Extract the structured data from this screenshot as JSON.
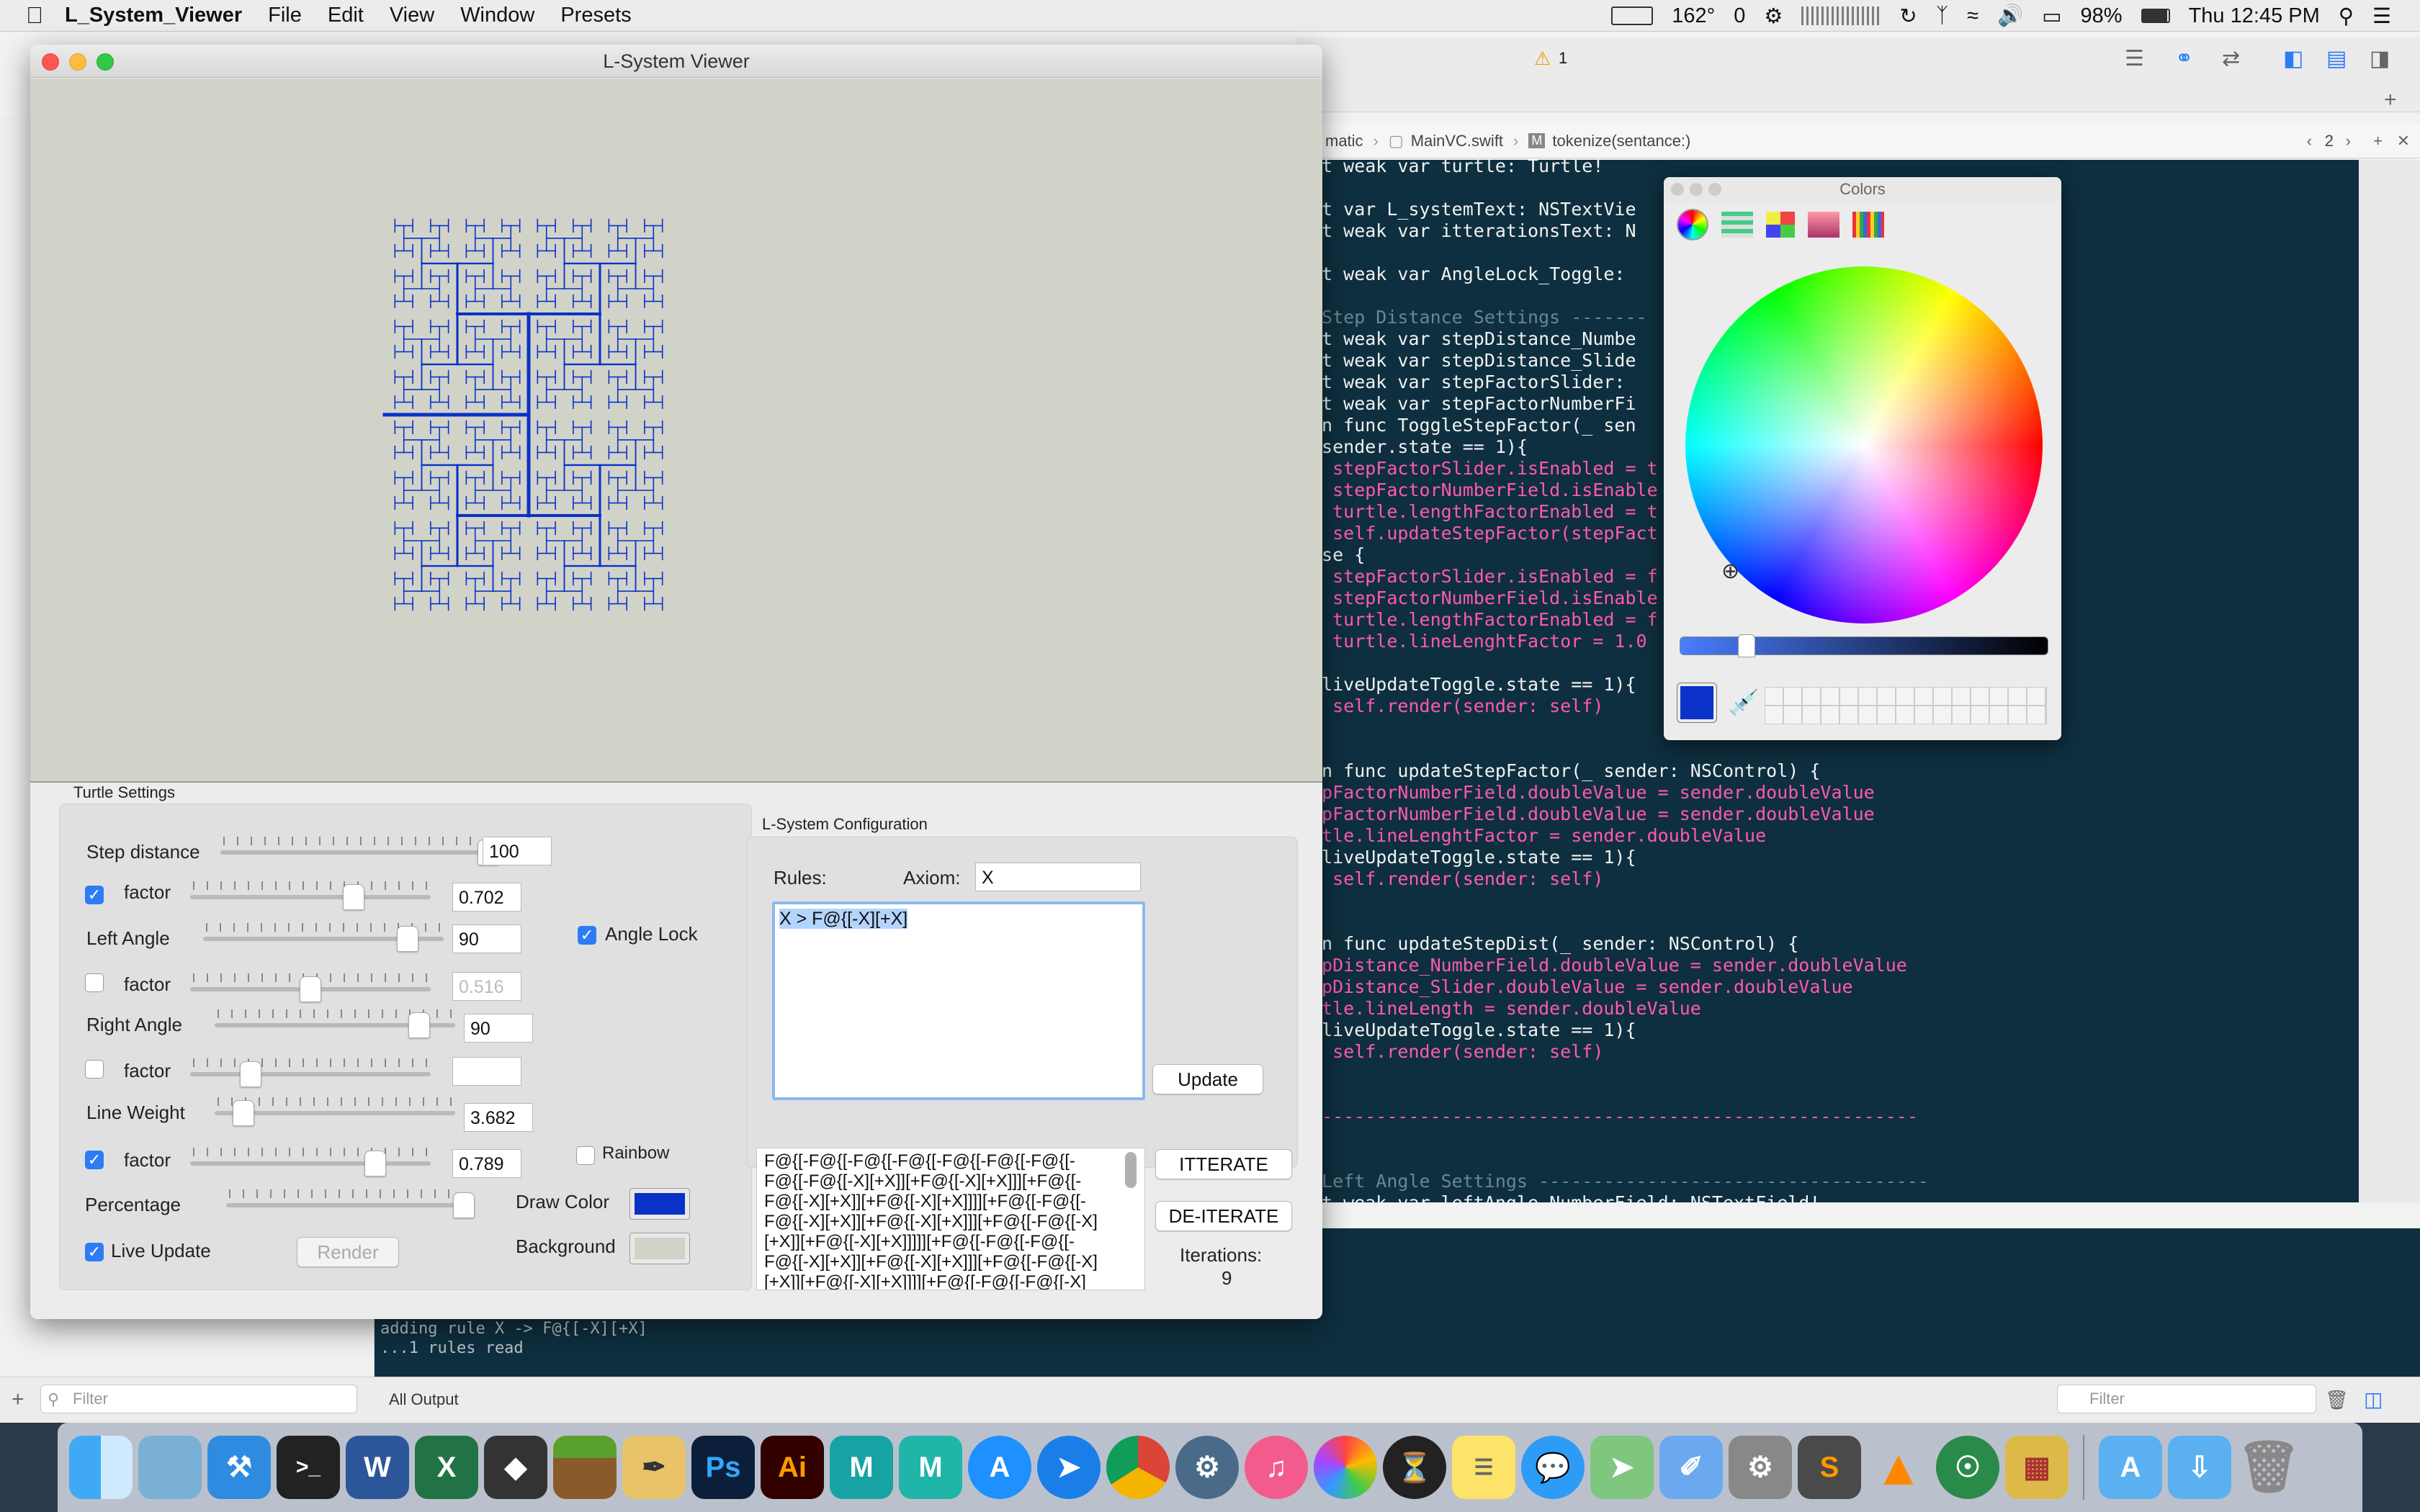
{
  "menubar": {
    "app_name": "L_System_Viewer",
    "items": [
      "File",
      "Edit",
      "View",
      "Window",
      "Presets"
    ],
    "temperature": "162°",
    "counter": "0",
    "battery": "98%",
    "clock": "Thu 12:45 PM"
  },
  "xcode": {
    "warning_count": "1",
    "breadcrumb": [
      "matic",
      "MainVC.swift",
      "tokenize(sentance:)"
    ],
    "page_counter": "2",
    "code_lines": [
      "et weak var turtle: Turtle!",
      "",
      "et var L_systemText: NSTextVie",
      "et weak var itterationsText: N",
      "",
      "et weak var AngleLock_Toggle: ",
      "",
      " Step Distance Settings -------",
      "et weak var stepDistance_Numbe",
      "et weak var stepDistance_Slide",
      "et weak var stepFactorSlider: ",
      "et weak var stepFactorNumberFi",
      "on func ToggleStepFactor(_ sen",
      "(sender.state == 1){",
      "  stepFactorSlider.isEnabled = t",
      "  stepFactorNumberField.isEnable",
      "  turtle.lengthFactorEnabled = t",
      "  self.updateStepFactor(stepFact",
      "lse {",
      "  stepFactorSlider.isEnabled = f",
      "  stepFactorNumberField.isEnable",
      "  turtle.lengthFactorEnabled = f",
      "  turtle.lineLenghtFactor = 1.0",
      "",
      "(liveUpdateToggle.state == 1){",
      "  self.render(sender: self)",
      "",
      "",
      "on func updateStepFactor(_ sender: NSControl) {",
      "epFactorNumberField.doubleValue = sender.doubleValue",
      "epFactorNumberField.doubleValue = sender.doubleValue",
      "rtle.lineLenghtFactor = sender.doubleValue",
      "(liveUpdateToggle.state == 1){",
      "  self.render(sender: self)",
      "",
      "",
      "on func updateStepDist(_ sender: NSControl) {",
      "epDistance_NumberField.doubleValue = sender.doubleValue",
      "epDistance_Slider.doubleValue = sender.doubleValue",
      "rtle.lineLength = sender.doubleValue",
      "(liveUpdateToggle.state == 1){",
      "  self.render(sender: self)",
      "",
      "",
      "--------------------------------------------------------",
      "",
      "",
      " Left Angle Settings ------------------------------------",
      "et weak var leftAngle_NumberField: NSTextField!"
    ],
    "console_lines": [
      "adding rule X -> F@{[-X][+X]",
      "...1 rules read"
    ],
    "filter_placeholder": "Filter",
    "output_selector": "All Output"
  },
  "window": {
    "title": "L-System Viewer",
    "draw_color": "#0a32c8",
    "background_color": "#d1d3c8"
  },
  "turtle": {
    "title": "Turtle Settings",
    "step_distance_label": "Step distance",
    "step_distance_value": "100",
    "step_distance_level": 1.0,
    "step_factor_label": "factor",
    "step_factor_checked": true,
    "step_factor_value": "0.702",
    "step_factor_level": 0.68,
    "left_angle_label": "Left Angle",
    "left_angle_value": "90",
    "left_angle_level": 0.85,
    "left_factor_label": "factor",
    "left_factor_checked": false,
    "left_factor_value": "0.516",
    "left_factor_level": 0.5,
    "right_angle_label": "Right Angle",
    "right_angle_value": "90",
    "right_angle_level": 0.85,
    "right_factor_label": "factor",
    "right_factor_checked": false,
    "right_factor_value": "",
    "right_factor_level": 0.25,
    "line_weight_label": "Line Weight",
    "line_weight_value": "3.682",
    "line_weight_level": 0.12,
    "weight_factor_label": "factor",
    "weight_factor_checked": true,
    "weight_factor_value": "0.789",
    "weight_factor_level": 0.77,
    "percentage_label": "Percentage",
    "percentage_level": 1.0,
    "angle_lock_label": "Angle Lock",
    "angle_lock_checked": true,
    "rainbow_label": "Rainbow",
    "rainbow_checked": false,
    "draw_color_label": "Draw Color",
    "background_label": "Background",
    "live_update_label": "Live Update",
    "live_update_checked": true,
    "render_label": "Render"
  },
  "lsystem": {
    "title": "L-System Configuration",
    "rules_label": "Rules:",
    "axiom_label": "Axiom:",
    "axiom_value": "X",
    "rules_text": "X > F@{[-X][+X]",
    "update_label": "Update",
    "output_lines": [
      "F@{[-F@{[-F@{[-F@{[-F@{[-F@{[-F@{[-",
      "F@{[-F@{[-X][+X]][+F@{[-X][+X]]][+F@{[-",
      "F@{[-X][+X]][+F@{[-X][+X]]]][+F@{[-F@{[-",
      "F@{[-X][+X]][+F@{[-X][+X]]][+F@{[-F@{[-X]",
      "[+X]][+F@{[-X][+X]]]]][+F@{[-F@{[-F@{[-",
      "F@{[-X][+X]][+F@{[-X][+X]]][+F@{[-F@{[-X]",
      "[+X]][+F@{[-X][+X]]]][+F@{[-F@{[-F@{[-X]"
    ],
    "iterate_label": "ITTERATE",
    "deiterate_label": "DE-ITERATE",
    "iterations_label": "Iterations:",
    "iterations_value": "9"
  },
  "colors_panel": {
    "title": "Colors",
    "selected_color": "#0a32c8",
    "brightness_level": 0.18
  }
}
